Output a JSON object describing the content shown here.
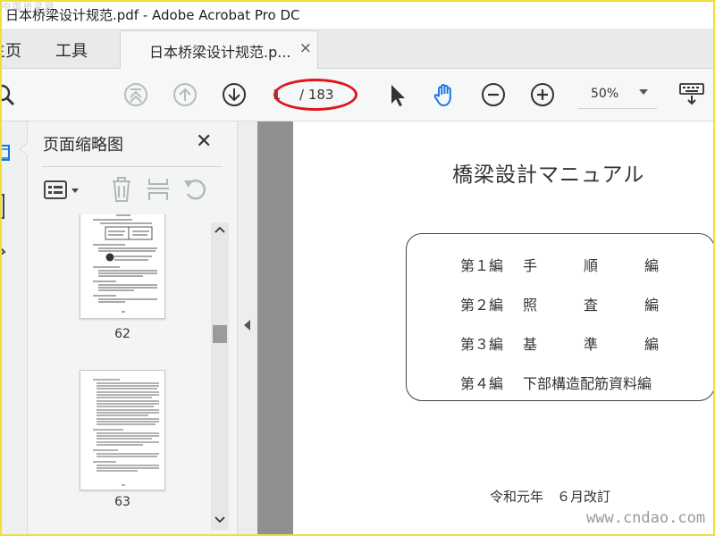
{
  "window": {
    "title": "日本桥梁设计规范.pdf - Adobe Acrobat Pro DC",
    "corner_watermark": "中国桥梁网"
  },
  "tabs": {
    "home": "主页",
    "tools": "工具",
    "document": "日本桥梁设计规范.p...",
    "close": "×"
  },
  "toolbar": {
    "icons": [
      "search-icon",
      "first-page-icon",
      "previous-page-icon",
      "next-page-icon",
      "select-cursor-icon",
      "hand-tool-icon",
      "zoom-out-icon",
      "zoom-in-icon",
      "keyboard-icon"
    ],
    "current_page": "1",
    "total_pages": "/ 183",
    "zoom": "50%",
    "highlight_color": "#e0141b",
    "active_tool_color": "#1473e6"
  },
  "thumbnails_panel": {
    "title": "页面缩略图",
    "close": "✕",
    "tools": [
      "page-options-icon",
      "delete-icon",
      "extract-icon",
      "rotate-icon"
    ],
    "pages": [
      {
        "number": "62"
      },
      {
        "number": "63"
      }
    ]
  },
  "document": {
    "title": "橋梁設計マニュアル",
    "volumes": [
      {
        "label": "第１編",
        "c1": "手",
        "c2": "順",
        "c3": "編"
      },
      {
        "label": "第２編",
        "c1": "照",
        "c2": "査",
        "c3": "編"
      },
      {
        "label": "第３編",
        "c1": "基",
        "c2": "準",
        "c3": "編"
      },
      {
        "label": "第４編",
        "c1": "下部構造配筋資料編",
        "c2": "",
        "c3": ""
      }
    ],
    "date": "令和元年　６月改訂"
  },
  "watermark": "www.cndao.com"
}
